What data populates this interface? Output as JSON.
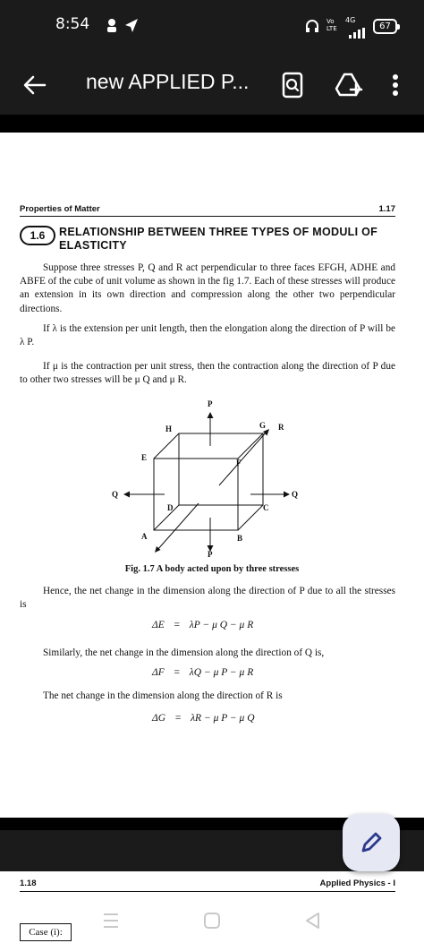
{
  "status": {
    "time": "8:54",
    "network": "4G",
    "battery": "67",
    "volte": "Vo LTE"
  },
  "appbar": {
    "title": "new APPLIED P..."
  },
  "page": {
    "header_left": "Properties of Matter",
    "header_right": "1.17",
    "section_number": "1.6",
    "section_title": "RELATIONSHIP BETWEEN THREE TYPES OF MODULI OF ELASTICITY",
    "para1": "Suppose three stresses P, Q and R act perpendicular to three faces EFGH, ADHE and ABFE of the cube of unit volume as shown in the fig 1.7. Each of these stresses will produce an extension in its own direction and compression along the other two perpendicular directions.",
    "para2": "If λ is the extension per unit length, then the elongation along the direction of P will be λ P.",
    "para3": "If μ is the contraction per unit stress, then the contraction along the direction of P due to other two stresses will be μ Q and μ R.",
    "figure_caption": "Fig. 1.7 A body acted upon by three stresses",
    "figure_labels": {
      "P_top": "P",
      "P_bottom": "P",
      "H": "H",
      "G": "G",
      "R": "R",
      "E": "E",
      "F": "F",
      "Q_left": "Q",
      "Q_right": "Q",
      "D": "D",
      "C": "C",
      "A": "A",
      "B": "B"
    },
    "para4": "Hence, the net change in the dimension along the direction of P due to all the stresses is",
    "eq1_lhs": "ΔE",
    "eq1_rhs": "λP − μ Q − μ R",
    "para5": "Similarly, the net change in the dimension along the direction of Q is,",
    "eq2_lhs": "ΔF",
    "eq2_rhs": "λQ − μ P − μ R",
    "para6": "The net change in the dimension along the direction of R is",
    "eq3_lhs": "ΔG",
    "eq3_rhs": "λR − μ P − μ Q",
    "eq_sign": "="
  },
  "page2": {
    "header_left": "1.18",
    "header_right": "Applied Physics - I",
    "case_label": "Case (i):"
  }
}
